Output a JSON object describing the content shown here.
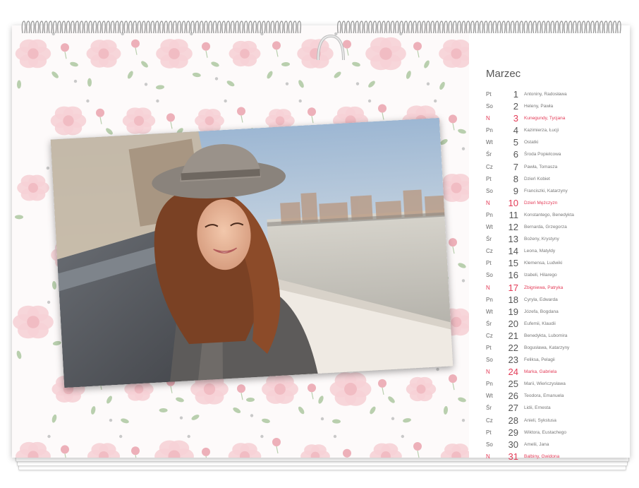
{
  "calendar": {
    "month": "Marzec",
    "accent_color": "#e33b57",
    "days": [
      {
        "dow": "Pt",
        "num": "1",
        "names": "Antoniny, Radosława",
        "sunday": false
      },
      {
        "dow": "So",
        "num": "2",
        "names": "Heleny, Pawła",
        "sunday": false
      },
      {
        "dow": "N",
        "num": "3",
        "names": "Kunegundy, Tycjana",
        "sunday": true
      },
      {
        "dow": "Pn",
        "num": "4",
        "names": "Kazimierza, Łucji",
        "sunday": false
      },
      {
        "dow": "Wt",
        "num": "5",
        "names": "Ostatki",
        "sunday": false
      },
      {
        "dow": "Śr",
        "num": "6",
        "names": "Środa Popielcowa",
        "sunday": false
      },
      {
        "dow": "Cz",
        "num": "7",
        "names": "Pawła, Tomasza",
        "sunday": false
      },
      {
        "dow": "Pt",
        "num": "8",
        "names": "Dzień Kobiet",
        "sunday": false
      },
      {
        "dow": "So",
        "num": "9",
        "names": "Franciszki, Katarzyny",
        "sunday": false
      },
      {
        "dow": "N",
        "num": "10",
        "names": "Dzień Mężczyzn",
        "sunday": true
      },
      {
        "dow": "Pn",
        "num": "11",
        "names": "Konstantego, Benedykta",
        "sunday": false
      },
      {
        "dow": "Wt",
        "num": "12",
        "names": "Bernarda, Grzegorza",
        "sunday": false
      },
      {
        "dow": "Śr",
        "num": "13",
        "names": "Bożeny, Krystyny",
        "sunday": false
      },
      {
        "dow": "Cz",
        "num": "14",
        "names": "Leona, Matyldy",
        "sunday": false
      },
      {
        "dow": "Pt",
        "num": "15",
        "names": "Klemensa, Ludwiki",
        "sunday": false
      },
      {
        "dow": "So",
        "num": "16",
        "names": "Izabeli, Hilarego",
        "sunday": false
      },
      {
        "dow": "N",
        "num": "17",
        "names": "Zbigniewa, Patryka",
        "sunday": true
      },
      {
        "dow": "Pn",
        "num": "18",
        "names": "Cyryla, Edwarda",
        "sunday": false
      },
      {
        "dow": "Wt",
        "num": "19",
        "names": "Józefa, Bogdana",
        "sunday": false
      },
      {
        "dow": "Śr",
        "num": "20",
        "names": "Eufemii, Klaudii",
        "sunday": false
      },
      {
        "dow": "Cz",
        "num": "21",
        "names": "Benedykta, Lubomira",
        "sunday": false
      },
      {
        "dow": "Pt",
        "num": "22",
        "names": "Bogusława, Katarzyny",
        "sunday": false
      },
      {
        "dow": "So",
        "num": "23",
        "names": "Feliksa, Pelagii",
        "sunday": false
      },
      {
        "dow": "N",
        "num": "24",
        "names": "Marka, Gabriela",
        "sunday": true
      },
      {
        "dow": "Pn",
        "num": "25",
        "names": "Marii, Wieńczysława",
        "sunday": false
      },
      {
        "dow": "Wt",
        "num": "26",
        "names": "Teodora, Emanuela",
        "sunday": false
      },
      {
        "dow": "Śr",
        "num": "27",
        "names": "Lidii, Ernesta",
        "sunday": false
      },
      {
        "dow": "Cz",
        "num": "28",
        "names": "Anieli, Sykstusa",
        "sunday": false
      },
      {
        "dow": "Pt",
        "num": "29",
        "names": "Wiktora, Eustachego",
        "sunday": false
      },
      {
        "dow": "So",
        "num": "30",
        "names": "Amelii, Jana",
        "sunday": false
      },
      {
        "dow": "N",
        "num": "31",
        "names": "Balbiny, Gwidona",
        "sunday": true
      }
    ]
  },
  "pattern": {
    "flower_color": "#f6d2d6",
    "bud_color": "#eaa2ad",
    "leaf_color": "#b9cfae",
    "dot_color": "#c9c9c9"
  }
}
